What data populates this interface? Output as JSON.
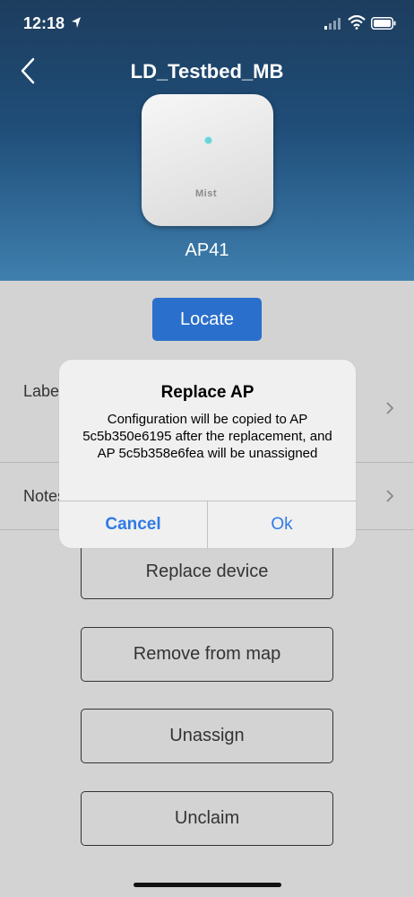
{
  "status_bar": {
    "time": "12:18"
  },
  "header": {
    "title": "LD_Testbed_MB",
    "device_name": "AP41",
    "device_brand": "Mist"
  },
  "actions": {
    "locate": "Locate"
  },
  "rows": [
    {
      "label": "Labels"
    },
    {
      "label": "Notes"
    }
  ],
  "buttons": [
    {
      "label": "Replace device"
    },
    {
      "label": "Remove from map"
    },
    {
      "label": "Unassign"
    },
    {
      "label": "Unclaim"
    }
  ],
  "dialog": {
    "title": "Replace AP",
    "message": "Configuration will be copied to AP 5c5b350e6195 after the replacement, and AP 5c5b358e6fea will be unassigned",
    "cancel": "Cancel",
    "ok": "Ok"
  },
  "colors": {
    "accent": "#2a6fcb",
    "dialog_button": "#2f7be6",
    "header_top": "#1d3d5e",
    "header_bottom": "#3f7fae"
  },
  "icons": [
    "location-arrow-icon",
    "signal-icon",
    "wifi-icon",
    "battery-icon",
    "back-chevron-icon",
    "chevron-right-icon"
  ]
}
